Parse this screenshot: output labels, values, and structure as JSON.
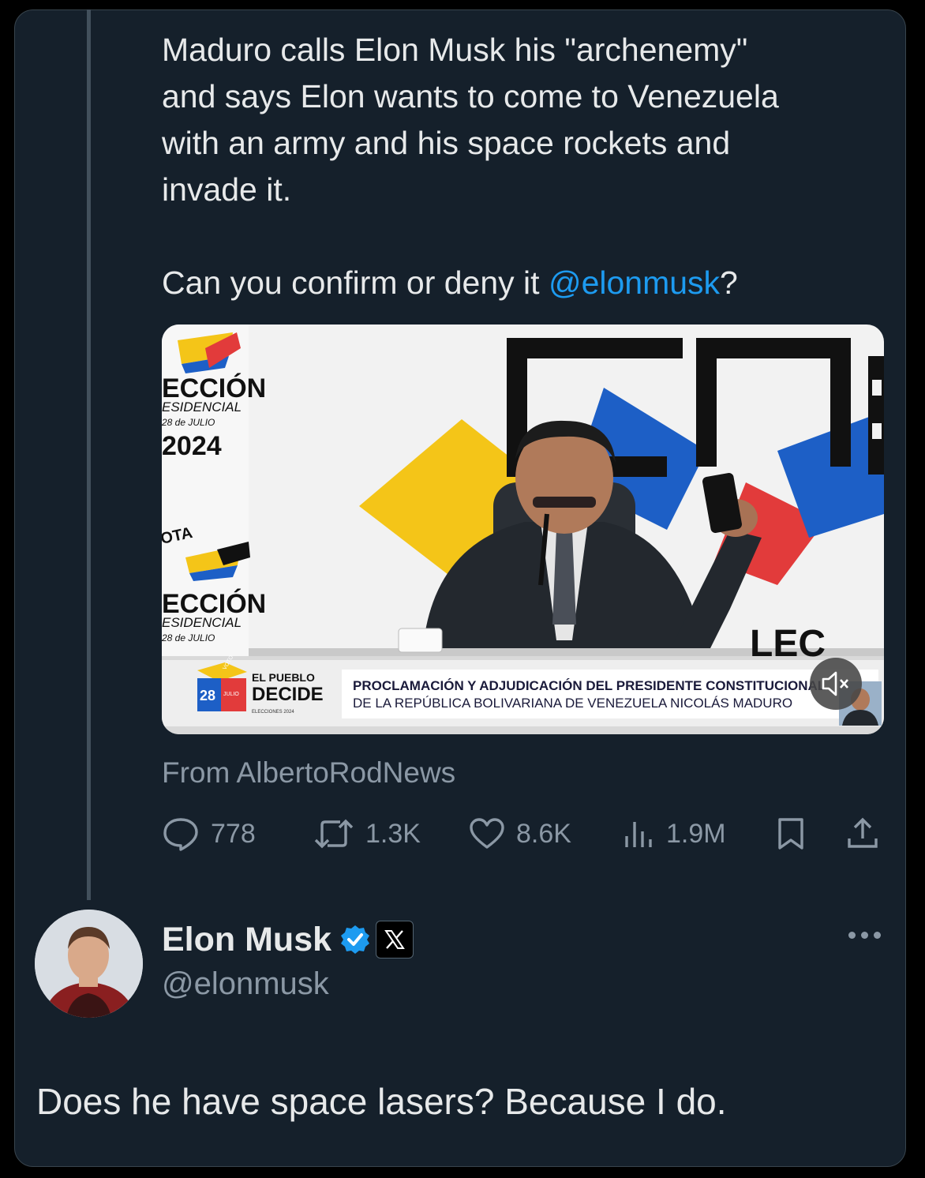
{
  "quoted_tweet": {
    "text_lines": [
      "Maduro calls Elon Musk his \"archenemy\"",
      "and says Elon wants to come to Venezuela",
      "with an army and his space rockets and",
      "invade it."
    ],
    "question_prefix": "Can you confirm or deny it ",
    "mention": "@elonmusk",
    "question_suffix": "?",
    "video": {
      "left_banner_1": "ECCIÓN",
      "left_banner_2": "ESIDENCIAL",
      "left_banner_3": "28 de JULIO",
      "left_banner_year": "2024",
      "left_banner_vota": "OTA",
      "left_banner_4": "ECCIÓN",
      "left_banner_5": "ESIDENCIAL",
      "left_banner_6": "28 de JULIO",
      "logo_day": "28",
      "logo_month": "JULIO",
      "logo_small": "VOTO",
      "logo_line1": "EL PUEBLO",
      "logo_line2": "DECIDE",
      "logo_line3": "ELECCIONES 2024",
      "chyron_line1": "PROCLAMACIÓN Y ADJUDICACIÓN DEL PRESIDENTE CONSTITUCIONAL",
      "chyron_line2": "DE LA REPÚBLICA BOLIVARIANA DE VENEZUELA NICOLÁS MADURO",
      "cne_sign_bottom": "LEC"
    },
    "source": "From AlbertoRodNews",
    "stats": {
      "replies": "778",
      "reposts": "1.3K",
      "likes": "8.6K",
      "views": "1.9M"
    }
  },
  "reply_tweet": {
    "display_name": "Elon Musk",
    "handle": "@elonmusk",
    "text": "Does he have space lasers? Because I do."
  },
  "icons": [
    "reply-icon",
    "repost-icon",
    "like-icon",
    "views-icon",
    "bookmark-icon",
    "share-icon",
    "verified-icon",
    "x-logo-icon",
    "mute-icon",
    "more-icon"
  ],
  "colors": {
    "background": "#15202b",
    "text": "#e7e9ea",
    "secondary_text": "#8b98a5",
    "accent": "#1d9bf0"
  }
}
